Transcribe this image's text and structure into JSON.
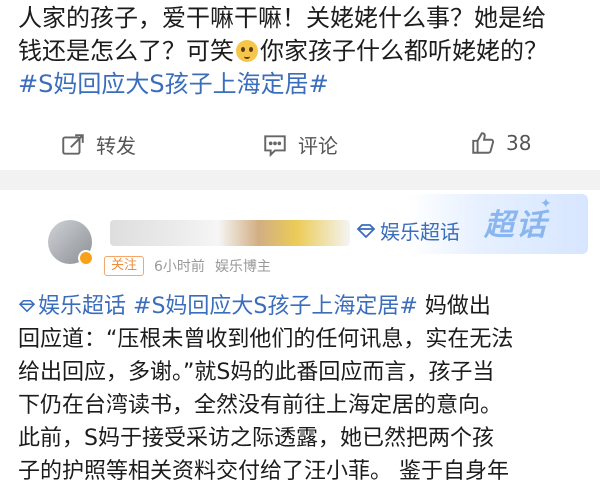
{
  "post1": {
    "lines": [
      "人家的孩子，爱干嘛干嘛！关姥姥什么事？她是给",
      "钱还是怎么了？可笑",
      "你家孩子什么都听姥姥的？"
    ],
    "hashtag": "#S妈回应大S孩子上海定居#",
    "actions": {
      "share": "转发",
      "comment": "评论",
      "like_count": "38"
    }
  },
  "post2": {
    "topic": "娱乐超话",
    "banner_word": "超话",
    "follow": "关注",
    "time": "6小时前",
    "source": "娱乐博主",
    "lead_topic": "娱乐超话",
    "hashtag": "#S妈回应大S孩子上海定居#",
    "line1_tail": " 妈做出",
    "lines": [
      "回应道：“压根未曾收到他们的任何讯息，实在无法",
      "给出回应，多谢。”就S妈的此番回应而言，孩子当",
      "下仍在台湾读书，全然没有前往上海定居的意向。",
      "此前，S妈于接受采访之际透露，她已然把两个孩",
      "子的护照等相关资料交付给了汪小菲。 鉴于自身年"
    ]
  },
  "colors": {
    "hashtag": "#3b6dbd",
    "follow": "#f08b3a",
    "separator": "#f2f2f2"
  }
}
